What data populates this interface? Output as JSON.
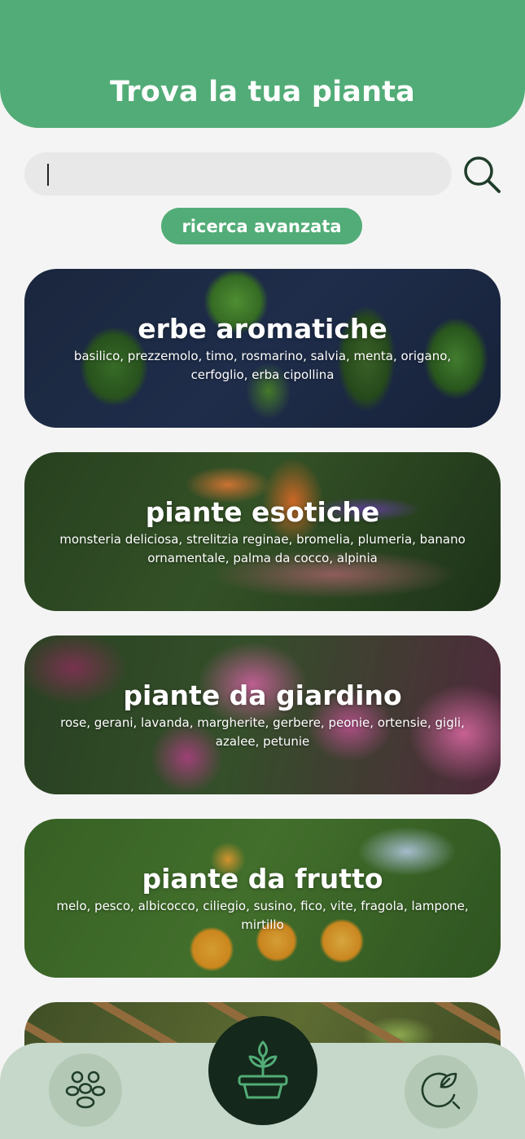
{
  "header": {
    "title": "Trova la tua pianta"
  },
  "search": {
    "value": "",
    "placeholder": "",
    "icon": "search-icon",
    "advanced_label": "ricerca avanzata"
  },
  "categories": [
    {
      "title": "erbe aromatiche",
      "subtitle": "basilico, prezzemolo, timo, rosmarino, salvia, menta, origano, cerfoglio, erba cipollina"
    },
    {
      "title": "piante esotiche",
      "subtitle": "monsteria deliciosa, strelitzia reginae, bromelia, plumeria, banano ornamentale, palma da cocco, alpinia"
    },
    {
      "title": "piante da giardino",
      "subtitle": "rose, gerani, lavanda, margherite, gerbere, peonie, ortensie, gigli, azalee, petunie"
    },
    {
      "title": "piante da frutto",
      "subtitle": "melo, pesco, albicocco, ciliegio, susino, fico, vite, fragola, lampone, mirtillo"
    },
    {
      "title": "",
      "subtitle": ""
    }
  ],
  "bottom_nav": {
    "left_icon": "community-icon",
    "center_icon": "potted-plant-icon",
    "right_icon": "plant-search-icon"
  },
  "colors": {
    "primary_green": "#52ac77",
    "background": "#f4f4f4",
    "search_field": "#e8e8e8",
    "nav_bar": "#c6d8c9",
    "nav_circle": "#b3c9b6",
    "nav_center": "#14281b",
    "icon_dark": "#1f3d2a"
  }
}
